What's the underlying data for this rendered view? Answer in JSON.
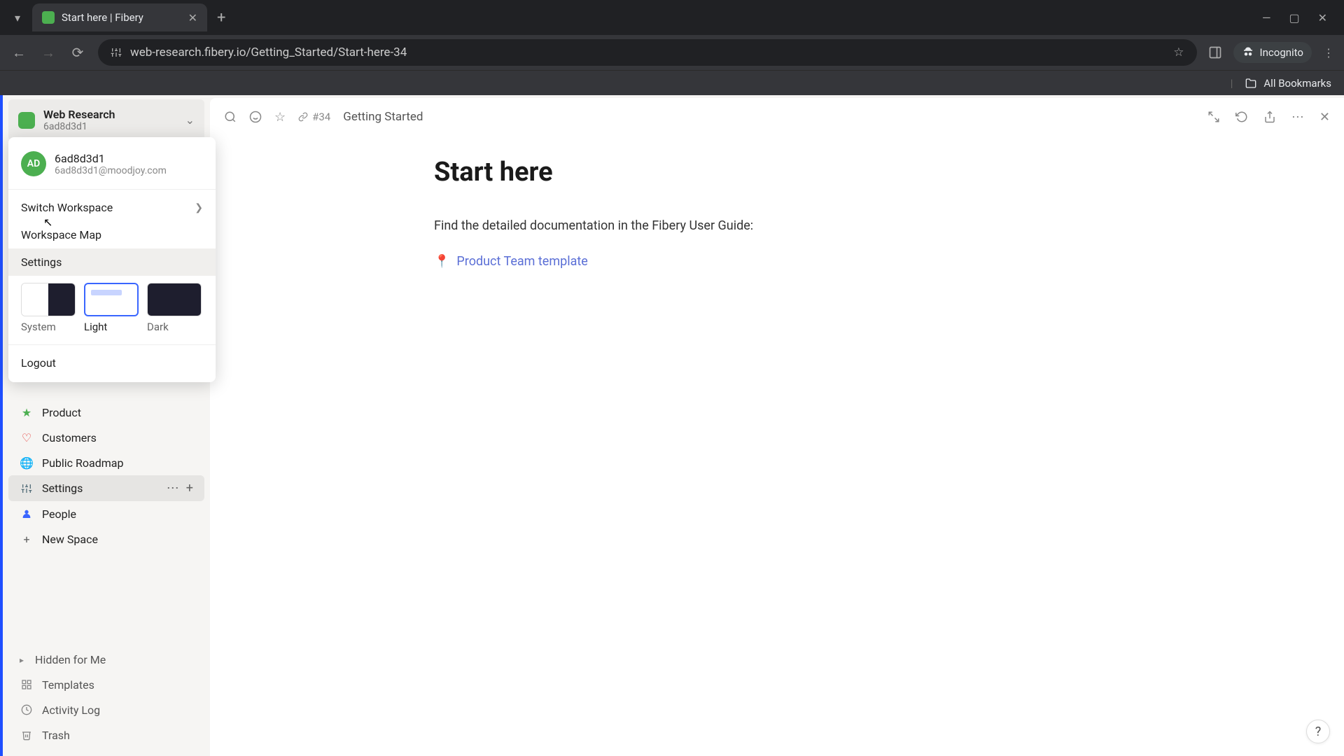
{
  "browser": {
    "tab_title": "Start here | Fibery",
    "url": "web-research.fibery.io/Getting_Started/Start-here-34",
    "incognito_label": "Incognito",
    "all_bookmarks": "All Bookmarks"
  },
  "workspace": {
    "name": "Web Research",
    "id": "6ad8d3d1"
  },
  "dropdown": {
    "avatar_initials": "AD",
    "user_name": "6ad8d3d1",
    "user_email": "6ad8d3d1@moodjoy.com",
    "switch_workspace": "Switch Workspace",
    "workspace_map": "Workspace Map",
    "settings": "Settings",
    "themes": {
      "system": "System",
      "light": "Light",
      "dark": "Dark"
    },
    "logout": "Logout"
  },
  "sidebar": {
    "items": [
      {
        "label": "Product"
      },
      {
        "label": "Customers"
      },
      {
        "label": "Public Roadmap"
      },
      {
        "label": "Settings"
      },
      {
        "label": "People"
      },
      {
        "label": "New Space"
      }
    ],
    "bottom": [
      {
        "label": "Hidden for Me"
      },
      {
        "label": "Templates"
      },
      {
        "label": "Activity Log"
      },
      {
        "label": "Trash"
      }
    ]
  },
  "main": {
    "entity_id": "#34",
    "breadcrumb": "Getting Started",
    "title": "Start here",
    "body": "Find the detailed documentation in the Fibery User Guide:",
    "link_text": "Product Team template"
  }
}
